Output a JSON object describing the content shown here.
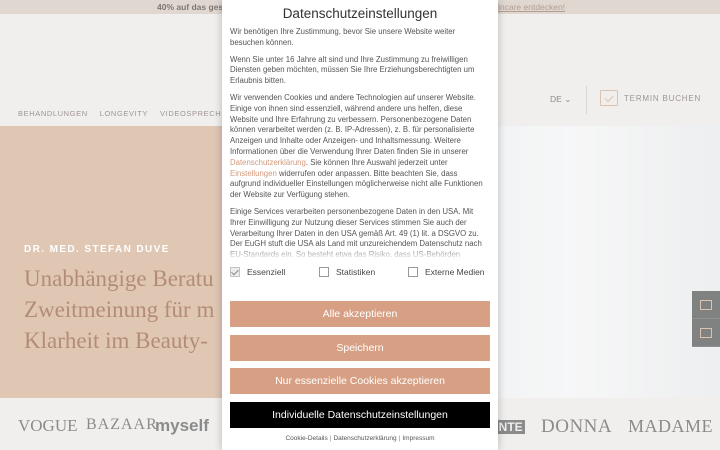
{
  "promo": {
    "left_text": "40% auf das gesa",
    "right_text": "incare entdecken!"
  },
  "nav": {
    "items": [
      "BEHANDLUNGEN",
      "LONGEVITY",
      "VIDEOSPRECHSTUN"
    ],
    "language": "DE",
    "cta": "TERMIN BUCHEN"
  },
  "hero": {
    "doctor_name": "DR. MED. STEFAN DUVE",
    "title_lines": [
      "Unabhängige Beratu",
      "Zweitmeinung für m",
      "Klarheit im Beauty-"
    ]
  },
  "press_logos": [
    "VOGUE",
    "BAZAAR",
    "myself",
    "UNTE",
    "DONNA",
    "MADAME"
  ],
  "consent": {
    "title": "Datenschutzeinstellungen",
    "paragraphs": {
      "p1": "Wir benötigen Ihre Zustimmung, bevor Sie unsere Website weiter besuchen können.",
      "p2": "Wenn Sie unter 16 Jahre alt sind und Ihre Zustimmung zu freiwilligen Diensten geben möchten, müssen Sie Ihre Erziehungsberechtigten um Erlaubnis bitten.",
      "p3a": "Wir verwenden Cookies und andere Technologien auf unserer Website. Einige von ihnen sind essenziell, während andere uns helfen, diese Website und Ihre Erfahrung zu verbessern. Personenbezogene Daten können verarbeitet werden (z. B. IP-Adressen), z. B. für personalisierte Anzeigen und Inhalte oder Anzeigen- und Inhaltsmessung. Weitere Informationen über die Verwendung Ihrer Daten finden Sie in unserer",
      "p3_link1": "Datenschutzerklärung",
      "p3b": ". Sie können Ihre Auswahl jederzeit unter",
      "p3_link2": "Einstellungen",
      "p3c": "widerrufen oder anpassen. Bitte beachten Sie, dass aufgrund individueller Einstellungen möglicherweise nicht alle Funktionen der Website zur Verfügung stehen.",
      "p4": "Einige Services verarbeiten personenbezogene Daten in den USA. Mit Ihrer Einwilligung zur Nutzung dieser Services stimmen Sie auch der Verarbeitung Ihrer Daten in den USA gemäß Art. 49 (1) lit. a DSGVO zu. Der EuGH stuft die USA als Land mit unzureichendem Datenschutz nach EU-Standards ein. So besteht etwa das Risiko, dass US-Behörden personenbezogene Daten in Überwachungsprogrammen verarbeiten."
    },
    "checkboxes": [
      {
        "label": "Essenziell",
        "checked": true
      },
      {
        "label": "Statistiken",
        "checked": false
      },
      {
        "label": "Externe Medien",
        "checked": false
      }
    ],
    "buttons": {
      "accept_all": "Alle akzeptieren",
      "save": "Speichern",
      "essential_only": "Nur essenzielle Cookies akzeptieren",
      "individual": "Individuelle Datenschutzeinstellungen"
    },
    "footer_links": [
      "Cookie-Details",
      "Datenschutzerklärung",
      "Impressum"
    ],
    "colors": {
      "accent": "#d7a084",
      "link": "#d39a7c",
      "dark_button": "#000000"
    }
  }
}
